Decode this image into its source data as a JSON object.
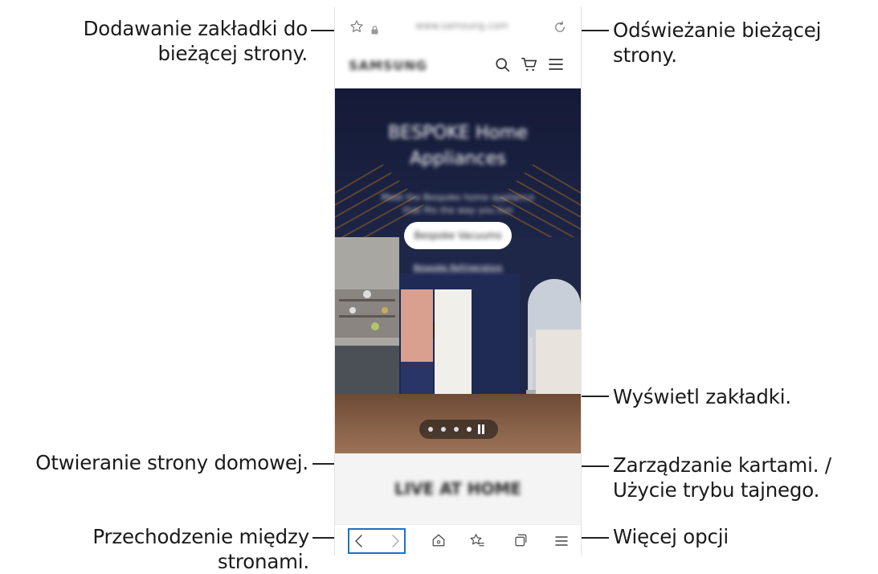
{
  "browser": {
    "url": "www.samsung.com",
    "site_logo": "SAMSUNG",
    "hero_heading": "BESPOKE Home Appliances",
    "hero_subtext": "Meet the Bespoke home appliance that fits the way you live",
    "hero_button_label": "Bespoke Vacuums",
    "hero_link_label": "Bespoke Refrigerators",
    "below_hero_heading": "LIVE AT HOME"
  },
  "callouts": {
    "bookmark": "Dodawanie zakładki do bieżącej strony.",
    "refresh": "Odświeżanie bieżącej strony.",
    "view_bookmarks": "Wyświetl zakładki.",
    "home": "Otwieranie strony domowej.",
    "tabs_line1": "Zarządzanie kartami. /",
    "tabs_line2": "Użycie trybu tajnego.",
    "navigation": "Przechodzenie między stronami.",
    "more_options": "Więcej opcji"
  },
  "colors": {
    "accent_blue": "#1a73c8",
    "hero_wall": "#1e2748",
    "cabinet_navy": "#1f2a55",
    "fridge_pink": "#d9a090",
    "floor_wood": "#8a5f43"
  },
  "icons": [
    "star-outline-icon",
    "lock-icon",
    "refresh-icon",
    "search-icon",
    "cart-icon",
    "menu-icon",
    "back-icon",
    "forward-icon",
    "home-icon",
    "bookmarks-icon",
    "tabs-icon"
  ]
}
